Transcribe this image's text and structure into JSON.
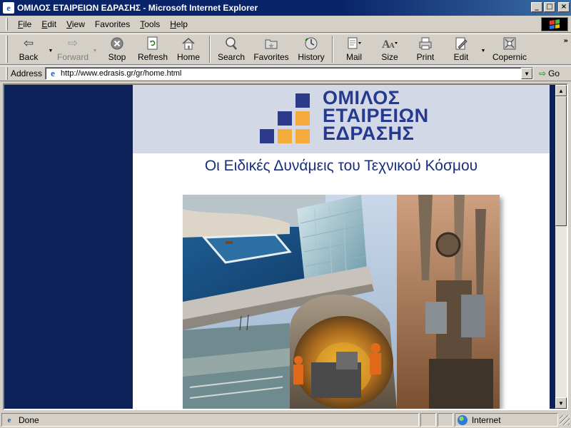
{
  "window": {
    "title": "ΟΜΙΛΟΣ ΕΤΑΙΡΕΙΩΝ ΕΔΡΑΣΗΣ - Microsoft Internet Explorer",
    "controls": {
      "minimize": "_",
      "maximize": "□",
      "close": "×"
    }
  },
  "menu": [
    {
      "key": "F",
      "rest": "ile"
    },
    {
      "key": "E",
      "rest": "dit"
    },
    {
      "key": "V",
      "rest": "iew"
    },
    {
      "key": "",
      "rest": "Favorites"
    },
    {
      "key": "T",
      "rest": "ools"
    },
    {
      "key": "H",
      "rest": "elp"
    }
  ],
  "toolbar": {
    "back": "Back",
    "forward": "Forward",
    "stop": "Stop",
    "refresh": "Refresh",
    "home": "Home",
    "search": "Search",
    "favorites": "Favorites",
    "history": "History",
    "mail": "Mail",
    "size": "Size",
    "print": "Print",
    "edit": "Edit",
    "copernic": "Copernic",
    "more": "»"
  },
  "address": {
    "label": "Address",
    "url": "http://www.edrasis.gr/gr/home.html",
    "go": "Go"
  },
  "page": {
    "logo": {
      "line1": "ΟΜΙΛΟΣ",
      "line2": "ΕΤΑΙΡΕΙΩΝ",
      "line3": "ΕΔΡΑΣΗΣ",
      "colors": {
        "navy": "#2c3a8c",
        "orange": "#f4ab3c"
      }
    },
    "slogan": "Οι Ειδικές Δυνάμεις του Τεχνικού Κόσμου",
    "colors": {
      "side_band": "#0c2157",
      "header_band": "#d2d8e6"
    }
  },
  "status": {
    "text": "Done",
    "zone": "Internet"
  },
  "icons": {
    "back": "back-arrow-icon",
    "forward": "forward-arrow-icon",
    "stop": "stop-icon",
    "refresh": "refresh-icon",
    "home": "home-icon",
    "search": "search-icon",
    "favorites": "favorites-folder-icon",
    "history": "history-icon",
    "mail": "mail-icon",
    "size": "font-size-icon",
    "print": "printer-icon",
    "edit": "edit-icon",
    "copernic": "copernic-icon"
  }
}
